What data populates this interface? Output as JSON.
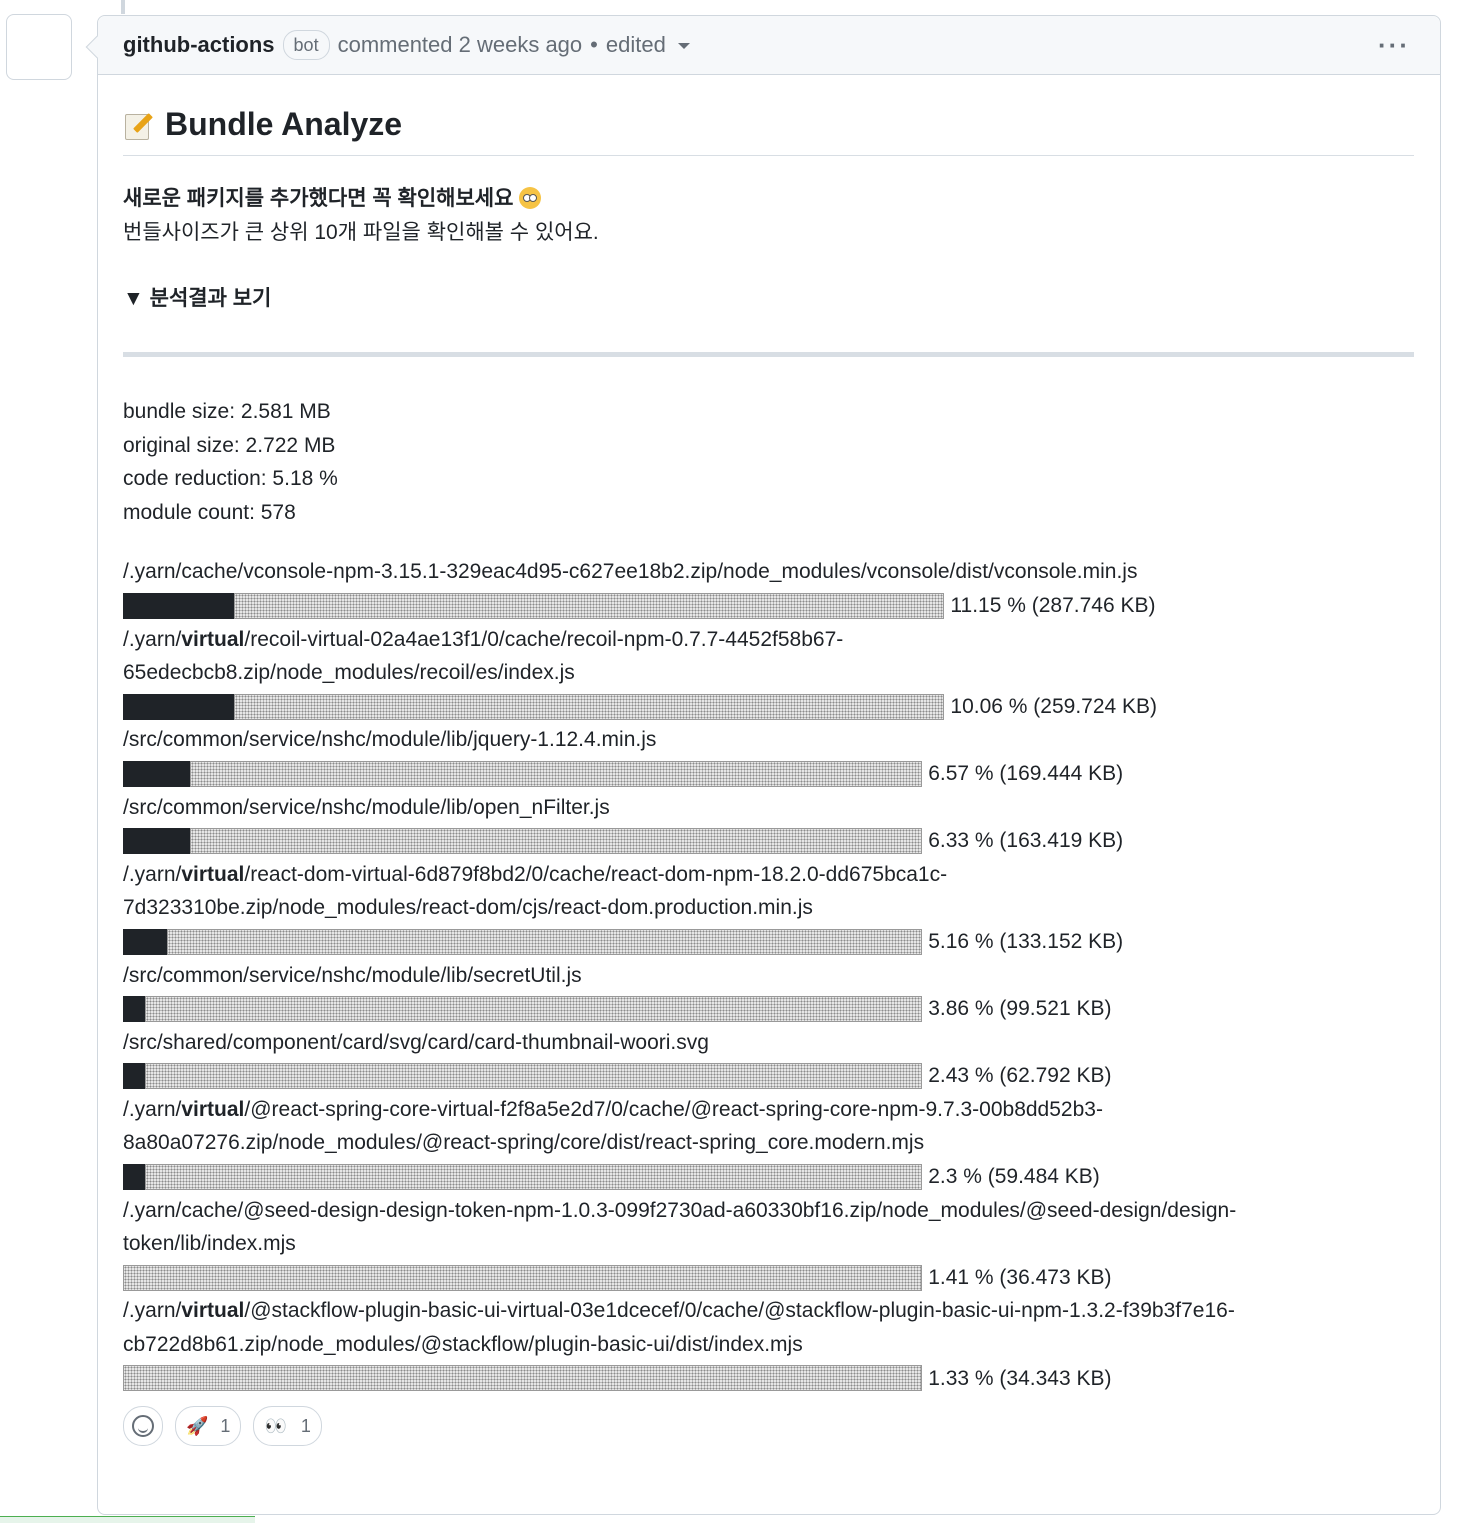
{
  "comment": {
    "author": "github-actions",
    "badge": "bot",
    "action": "commented 2 weeks ago",
    "separator": "•",
    "edited": "edited",
    "menu": "···"
  },
  "heading": "Bundle Analyze",
  "intro": {
    "line1": "새로운 패키지를 추가했다면 꼭 확인해보세요",
    "line2": "번들사이즈가 큰 상위 10개 파일을 확인해볼 수 있어요."
  },
  "details_summary": "▼ 분석결과 보기",
  "stats": {
    "bundle_size": "bundle size: 2.581 MB",
    "original_size": "original size: 2.722 MB",
    "code_reduction": "code reduction: 5.18 %",
    "module_count": "module count: 578"
  },
  "files": [
    {
      "path_pre": "/.yarn/cache/vconsole-npm-3.15.1-329eac4d95-c627ee18b2.zip/node_modules/vconsole/dist/vconsole.min.js",
      "path_bold": "",
      "path_post": "",
      "filled_blocks": 5,
      "empty_blocks": 32,
      "percent": 11.15,
      "label": "11.15 % (287.746 KB)"
    },
    {
      "path_pre": "/.yarn/",
      "path_bold": "virtual",
      "path_post": "/recoil-virtual-02a4ae13f1/0/cache/recoil-npm-0.7.7-4452f58b67-\n65edecbcb8.zip/node_modules/recoil/es/index.js",
      "filled_blocks": 5,
      "empty_blocks": 32,
      "percent": 10.06,
      "label": "10.06 % (259.724 KB)"
    },
    {
      "path_pre": "/src/common/service/nshc/module/lib/jquery-1.12.4.min.js",
      "path_bold": "",
      "path_post": "",
      "filled_blocks": 3,
      "empty_blocks": 33,
      "percent": 6.57,
      "label": "6.57 % (169.444 KB)"
    },
    {
      "path_pre": "/src/common/service/nshc/module/lib/open_nFilter.js",
      "path_bold": "",
      "path_post": "",
      "filled_blocks": 3,
      "empty_blocks": 33,
      "percent": 6.33,
      "label": "6.33 % (163.419 KB)"
    },
    {
      "path_pre": "/.yarn/",
      "path_bold": "virtual",
      "path_post": "/react-dom-virtual-6d879f8bd2/0/cache/react-dom-npm-18.2.0-dd675bca1c-\n7d323310be.zip/node_modules/react-dom/cjs/react-dom.production.min.js",
      "filled_blocks": 2,
      "empty_blocks": 34,
      "percent": 5.16,
      "label": "5.16 % (133.152 KB)"
    },
    {
      "path_pre": "/src/common/service/nshc/module/lib/secretUtil.js",
      "path_bold": "",
      "path_post": "",
      "filled_blocks": 1,
      "empty_blocks": 35,
      "percent": 3.86,
      "label": "3.86 % (99.521 KB)"
    },
    {
      "path_pre": "/src/shared/component/card/svg/card/card-thumbnail-woori.svg",
      "path_bold": "",
      "path_post": "",
      "filled_blocks": 1,
      "empty_blocks": 35,
      "percent": 2.43,
      "label": "2.43 % (62.792 KB)"
    },
    {
      "path_pre": "/.yarn/",
      "path_bold": "virtual",
      "path_post": "/@react-spring-core-virtual-f2f8a5e2d7/0/cache/@react-spring-core-npm-9.7.3-00b8dd52b3-\n8a80a07276.zip/node_modules/@react-spring/core/dist/react-spring_core.modern.mjs",
      "filled_blocks": 1,
      "empty_blocks": 35,
      "percent": 2.3,
      "label": "2.3 % (59.484 KB)"
    },
    {
      "path_pre": "/.yarn/cache/@seed-design-design-token-npm-1.0.3-099f2730ad-a60330bf16.zip/node_modules/@seed-design/design-\ntoken/lib/index.mjs",
      "path_bold": "",
      "path_post": "",
      "filled_blocks": 0,
      "empty_blocks": 36,
      "percent": 1.41,
      "label": "1.41 % (36.473 KB)"
    },
    {
      "path_pre": "/.yarn/",
      "path_bold": "virtual",
      "path_post": "/@stackflow-plugin-basic-ui-virtual-03e1dcecef/0/cache/@stackflow-plugin-basic-ui-npm-1.3.2-f39b3f7e16-\ncb722d8b61.zip/node_modules/@stackflow/plugin-basic-ui/dist/index.mjs",
      "filled_blocks": 0,
      "empty_blocks": 36,
      "percent": 1.33,
      "label": "1.33 % (34.343 KB)"
    }
  ],
  "reactions": {
    "rocket_count": "1",
    "eyes_count": "1"
  },
  "icons": [
    "memo-icon",
    "face-icon",
    "smiley-icon",
    "rocket-icon",
    "eyes-icon",
    "kebab-icon",
    "caret-down-icon"
  ]
}
